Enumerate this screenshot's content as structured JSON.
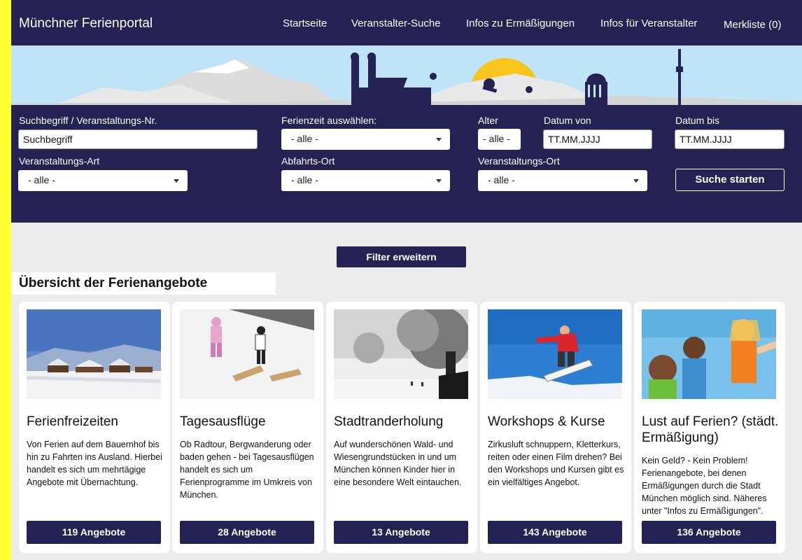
{
  "header": {
    "brand": "Münchner Ferienportal",
    "nav": [
      "Startseite",
      "Veranstalter-Suche",
      "Infos zu Ermäßigungen",
      "Infos für Veranstalter",
      "Merkliste (0)"
    ]
  },
  "search": {
    "term_label": "Suchbegriff / Veranstaltungs-Nr.",
    "term_value": "Suchbegriff",
    "ferienzeit_label": "Ferienzeit auswählen:",
    "ferienzeit_value": "- alle -",
    "alter_label": "Alter",
    "alter_value": "- alle -",
    "datum_von_label": "Datum von",
    "datum_von_value": "TT.MM.JJJJ",
    "datum_bis_label": "Datum bis",
    "datum_bis_value": "TT.MM.JJJJ",
    "art_label": "Veranstaltungs-Art",
    "art_value": "- alle -",
    "abfahrt_label": "Abfahrts-Ort",
    "abfahrt_value": "- alle -",
    "ort_label": "Veranstaltungs-Ort",
    "ort_value": "- alle -",
    "submit_label": "Suche starten"
  },
  "filter_label": "Filter erweitern",
  "section_title": "Übersicht der Ferienangebote",
  "cards": [
    {
      "title": "Ferienfreizeiten",
      "text": "Von Ferien auf dem Bauernhof bis hin zu Fahrten ins Ausland. Hierbei handelt es sich um mehrtägige Angebote mit Übernachtung.",
      "button": "119 Angebote"
    },
    {
      "title": "Tagesausflüge",
      "text": "Ob Radtour, Bergwanderung oder baden gehen - bei Tagesausflügen handelt es sich um Ferienprogramme im Umkreis von München.",
      "button": "28 Angebote"
    },
    {
      "title": "Stadtranderholung",
      "text": "Auf wunderschönen Wald- und Wiesengrundstücken in und um München können Kinder hier in eine besondere Welt eintauchen.",
      "button": "13 Angebote"
    },
    {
      "title": "Workshops & Kurse",
      "text": "Zirkusluft schnuppern, Kletterkurs, reiten oder einen Film drehen? Bei den Workshops und Kursen gibt es ein vielfältiges Angebot.",
      "button": "143 Angebote"
    },
    {
      "title": "Lust auf Ferien? (städt. Ermäßigung)",
      "text": "Kein Geld? - Kein Problem! Ferienangebote, bei denen Ermäßigungen durch die Stadt München möglich sind. Näheres unter \"Infos zu Ermäßigungen\".",
      "button": "136 Angebote"
    }
  ],
  "colors": {
    "navy": "#232252",
    "accent_border": "#ffff33",
    "page_bg": "#ececec"
  }
}
